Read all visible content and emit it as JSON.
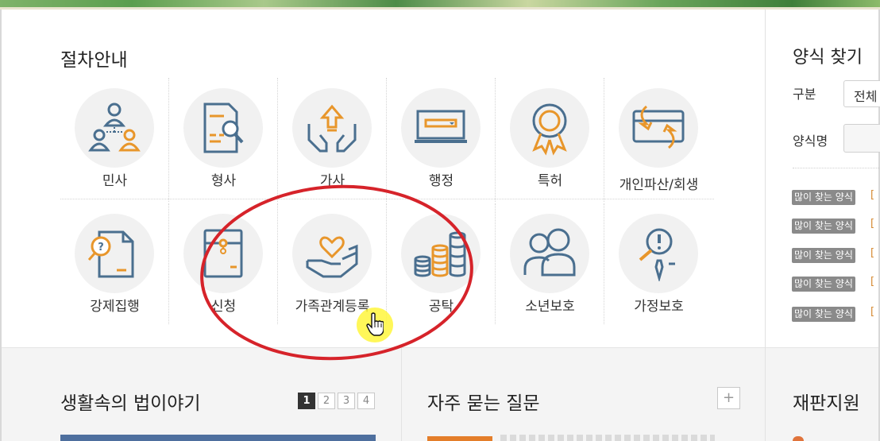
{
  "procedure": {
    "title": "절차안내",
    "items": [
      {
        "label": "민사",
        "icon": "people-network-icon"
      },
      {
        "label": "형사",
        "icon": "document-magnifier-icon"
      },
      {
        "label": "가사",
        "icon": "hands-house-icon"
      },
      {
        "label": "행정",
        "icon": "monitor-icon"
      },
      {
        "label": "특허",
        "icon": "award-ribbon-icon"
      },
      {
        "label": "개인파산/회생",
        "icon": "card-arrows-icon"
      },
      {
        "label": "강제집행",
        "icon": "document-question-icon"
      },
      {
        "label": "신청",
        "icon": "envelope-icon"
      },
      {
        "label": "가족관계등록",
        "icon": "hand-heart-icon"
      },
      {
        "label": "공탁",
        "icon": "coin-stacks-icon"
      },
      {
        "label": "소년보호",
        "icon": "two-people-icon"
      },
      {
        "label": "가정보호",
        "icon": "warning-magnifier-icon"
      }
    ]
  },
  "form_finder": {
    "title": "양식 찾기",
    "category_label": "구분",
    "category_value": "전체",
    "name_label": "양식명",
    "popular_badge": "많이 찾는 양식",
    "popular_bracket": "[",
    "popular_count": 5
  },
  "bottom": {
    "law_story_title": "생활속의 법이야기",
    "pages": [
      "1",
      "2",
      "3",
      "4"
    ],
    "active_page": "1",
    "faq_title": "자주 묻는 질문",
    "faq_more": "+",
    "trial_support_title": "재판지원"
  },
  "colors": {
    "icon_blue": "#4a6f8f",
    "icon_orange": "#e8962b",
    "circle_bg": "#f1f1f1",
    "annotation_red": "#d6232a",
    "cursor_highlight": "#fff63c",
    "popular_badge_bg": "#8a8a8a"
  }
}
